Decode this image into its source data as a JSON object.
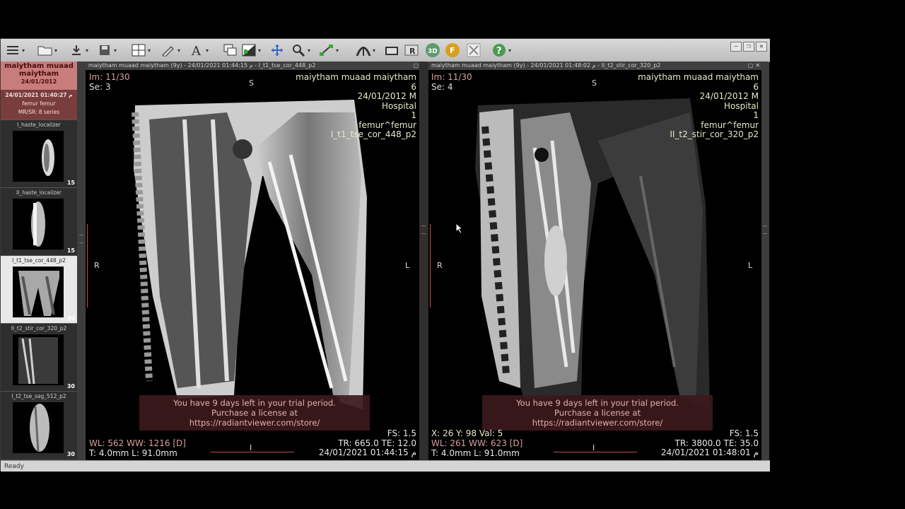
{
  "toolbar": {
    "items": [
      "layout-menu",
      "open",
      "download",
      "save",
      "grid-layout",
      "measure",
      "text",
      "series",
      "window-level",
      "pan",
      "zoom",
      "ruler",
      "mpr",
      "snapshot",
      "rotate",
      "3d",
      "fusion",
      "tools",
      "help"
    ]
  },
  "window_controls": [
    "—",
    "❐",
    "✕"
  ],
  "patient": {
    "name": "maiytham muaad maiytham",
    "dob": "24/01/2012"
  },
  "study": {
    "datetime": "24/01/2021 01:40:27 م",
    "description": "femur femur",
    "modality": "MR/SR: 8 series"
  },
  "series": [
    {
      "label": "I_haste_localizer",
      "count": "15"
    },
    {
      "label": "II_haste_localizer",
      "count": "15"
    },
    {
      "label": "I_t1_tse_cor_448_p2",
      "count": "30"
    },
    {
      "label": "II_t2_stir_cor_320_p2",
      "count": "30"
    },
    {
      "label": "I_t2_tse_sag_512_p2",
      "count": "30"
    }
  ],
  "viewports": [
    {
      "title": "maiytham muaad maiytham (9y) - 24/01/2021 01:44:15 م - I_t1_tse_cor_448_p2",
      "im": "Im: 11/30",
      "se": "Se: 3",
      "top_right": [
        "maiytham muaad maiytham",
        "6",
        "24/01/2012 M",
        "Hospital",
        "1",
        "femur^femur",
        "I_t1_tse_cor_448_p2"
      ],
      "orient": {
        "top": "S",
        "left": "R",
        "right": "L",
        "bottom": "I"
      },
      "bottom_left_1": "WL: 562 WW: 1216 [D]",
      "bottom_left_2": "T: 4.0mm L: 91.0mm",
      "bottom_right": [
        "FS: 1.5",
        "TR: 665.0 TE: 12.0",
        "24/01/2021 01:44:15 م"
      ],
      "trial_1": "You have 9 days left in your trial period.",
      "trial_2": "Purchase a license at https://radiantviewer.com/store/"
    },
    {
      "title": "maiytham muaad maiytham (9y) - 24/01/2021 01:48:02 م - II_t2_stir_cor_320_p2",
      "im": "Im: 11/30",
      "se": "Se: 4",
      "top_right": [
        "maiytham muaad maiytham",
        "6",
        "24/01/2012 M",
        "Hospital",
        "1",
        "femur^femur",
        "II_t2_stir_cor_320_p2"
      ],
      "orient": {
        "top": "S",
        "left": "R",
        "right": "L",
        "bottom": "I"
      },
      "bottom_left_0": "X: 26 Y: 98 Val: 5",
      "bottom_left_1": "WL: 261 WW: 623 [D]",
      "bottom_left_2": "T: 4.0mm L: 91.0mm",
      "bottom_right": [
        "FS: 1.5",
        "TR: 3800.0 TE: 35.0",
        "24/01/2021 01:48:01 م"
      ],
      "trial_1": "You have 9 days left in your trial period.",
      "trial_2": "Purchase a license at https://radiantviewer.com/store/"
    }
  ],
  "status": "Ready"
}
